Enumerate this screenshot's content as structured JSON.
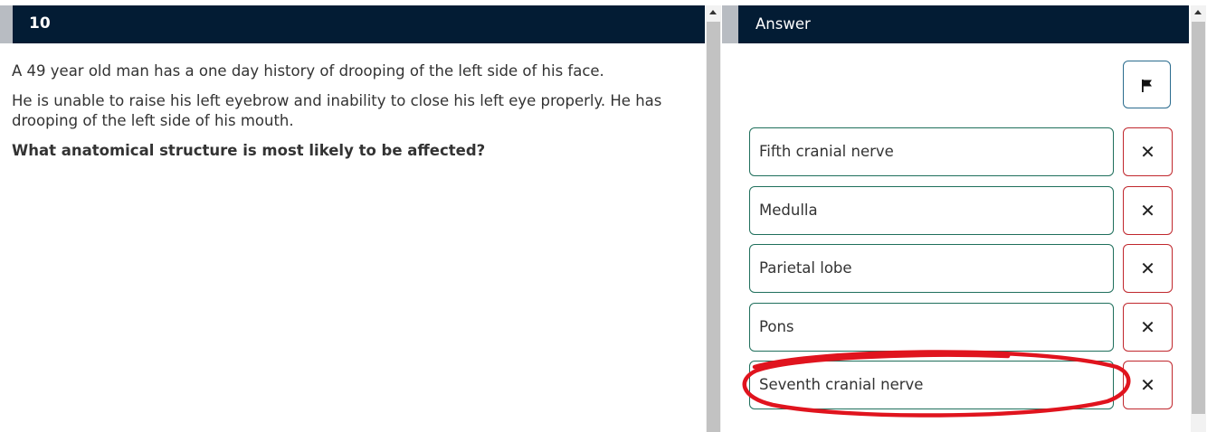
{
  "question_panel": {
    "number": "10",
    "paragraphs": [
      "A 49 year old man has a one day history of drooping of the left side of his face.",
      "He is unable to raise his left eyebrow and inability to close his left eye properly. He has drooping of the left side of his mouth."
    ],
    "stem": "What anatomical structure is most likely to be affected?"
  },
  "answer_panel": {
    "title": "Answer",
    "eliminate_symbol": "✕",
    "options": [
      {
        "label": "Fifth cranial nerve"
      },
      {
        "label": "Medulla"
      },
      {
        "label": "Parietal lobe"
      },
      {
        "label": "Pons"
      },
      {
        "label": "Seventh cranial nerve"
      }
    ]
  },
  "icons": {
    "flag": "flag-icon",
    "eliminate": "close-icon",
    "scroll_up": "chevron-up-icon"
  },
  "colors": {
    "header_bg": "#031c34",
    "option_border": "#1f6f5c",
    "eliminate_border": "#c0272d",
    "flag_border": "#2b6c8e",
    "annotation": "#e0141e"
  }
}
